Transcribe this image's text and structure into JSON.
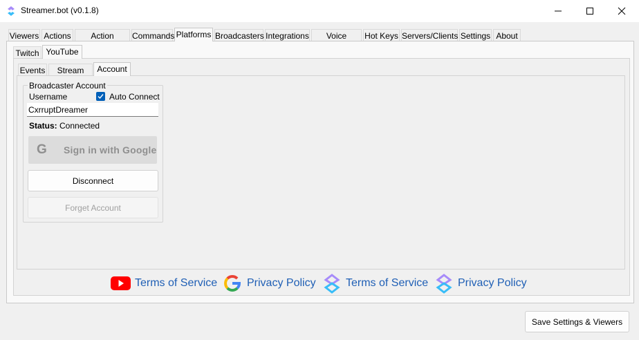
{
  "window": {
    "title": "Streamer.bot (v0.1.8)"
  },
  "main_tabs": [
    {
      "label": "Viewers"
    },
    {
      "label": "Actions"
    },
    {
      "label": "Action Queues"
    },
    {
      "label": "Commands"
    },
    {
      "label": "Platforms",
      "active": true
    },
    {
      "label": "Broadcasters"
    },
    {
      "label": "Integrations"
    },
    {
      "label": "Voice Control"
    },
    {
      "label": "Hot Keys"
    },
    {
      "label": "Servers/Clients"
    },
    {
      "label": "Settings"
    },
    {
      "label": "About"
    }
  ],
  "platform_tabs": [
    {
      "label": "Twitch"
    },
    {
      "label": "YouTube",
      "active": true
    }
  ],
  "youtube_tabs": [
    {
      "label": "Events"
    },
    {
      "label": "Stream Info"
    },
    {
      "label": "Account",
      "active": true
    }
  ],
  "account": {
    "group_title": "Broadcaster Account",
    "username_label": "Username",
    "auto_connect_label": "Auto Connect",
    "auto_connect_checked": true,
    "username_value": "CxrruptDreamer",
    "status_label": "Status:",
    "status_value": "Connected",
    "google_sign_in": "Sign in with Google",
    "disconnect": "Disconnect",
    "forget_account": "Forget Account"
  },
  "footer": {
    "links": [
      {
        "icon": "youtube-icon",
        "label": "Terms of Service"
      },
      {
        "icon": "google-icon",
        "label": "Privacy Policy"
      },
      {
        "icon": "streamerbot-icon",
        "label": "Terms of Service"
      },
      {
        "icon": "streamerbot-icon",
        "label": "Privacy Policy"
      }
    ]
  },
  "save_button": "Save Settings & Viewers",
  "colors": {
    "accent": "#005fb8",
    "link": "#1f5fb5",
    "youtube_red": "#ff0000",
    "streamerbot_purple": "#8b5cf6",
    "streamerbot_cyan": "#38bdf8"
  }
}
